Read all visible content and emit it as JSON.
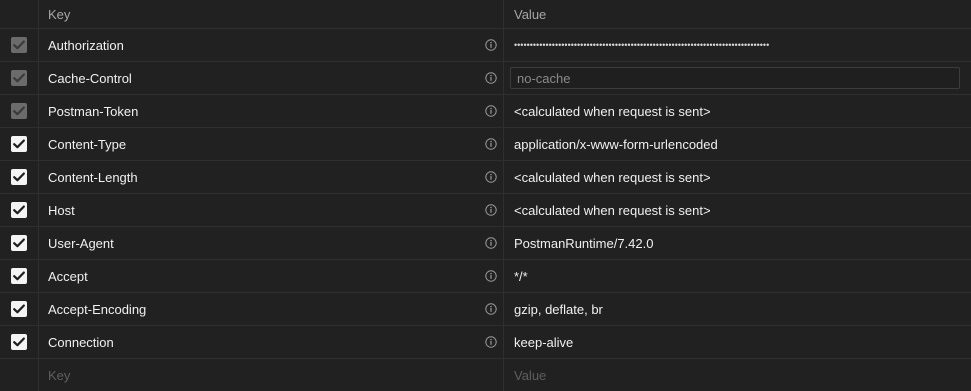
{
  "header": {
    "key_label": "Key",
    "value_label": "Value"
  },
  "rows": [
    {
      "enabled": true,
      "locked": true,
      "key": "Authorization",
      "value": "•••••••••••••••••••••••••••••••••••••••••••••••••••••••••••••••••••••••••••••••••",
      "masked": true
    },
    {
      "enabled": true,
      "locked": true,
      "key": "Cache-Control",
      "value": "no-cache",
      "editing": true
    },
    {
      "enabled": true,
      "locked": true,
      "key": "Postman-Token",
      "value": "<calculated when request is sent>"
    },
    {
      "enabled": true,
      "locked": false,
      "key": "Content-Type",
      "value": "application/x-www-form-urlencoded"
    },
    {
      "enabled": true,
      "locked": false,
      "key": "Content-Length",
      "value": "<calculated when request is sent>"
    },
    {
      "enabled": true,
      "locked": false,
      "key": "Host",
      "value": "<calculated when request is sent>"
    },
    {
      "enabled": true,
      "locked": false,
      "key": "User-Agent",
      "value": "PostmanRuntime/7.42.0"
    },
    {
      "enabled": true,
      "locked": false,
      "key": "Accept",
      "value": "*/*"
    },
    {
      "enabled": true,
      "locked": false,
      "key": "Accept-Encoding",
      "value": "gzip, deflate, br"
    },
    {
      "enabled": true,
      "locked": false,
      "key": "Connection",
      "value": "keep-alive"
    }
  ],
  "new_row": {
    "key_placeholder": "Key",
    "value_placeholder": "Value"
  },
  "icons": {
    "row_info": "info-icon",
    "checkbox": "checkmark-icon"
  }
}
